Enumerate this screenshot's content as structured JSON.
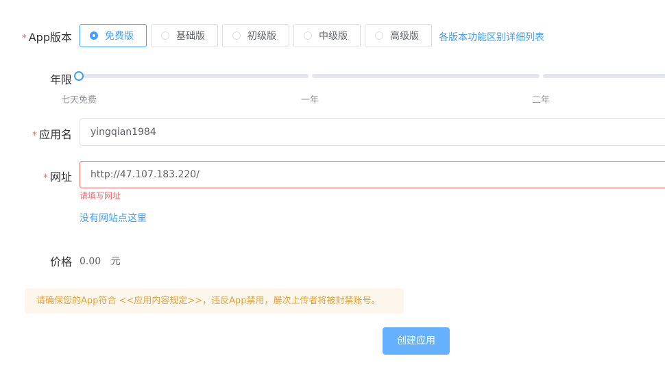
{
  "form": {
    "version": {
      "label": "App版本",
      "options": [
        "免费版",
        "基础版",
        "初级版",
        "中级版",
        "高级版"
      ],
      "selected": "免费版",
      "compare_link": "各版本功能区别详细列表"
    },
    "years": {
      "label": "年限",
      "ticks": [
        "七天免费",
        "一年",
        "二年"
      ],
      "value": "七天免费"
    },
    "app_name": {
      "label": "应用名",
      "value": "yingqian1984"
    },
    "website": {
      "label": "网址",
      "value": "http://47.107.183.220/",
      "error": "请填写网址",
      "help_link": "没有网站点这里"
    },
    "price": {
      "label": "价格",
      "value": "0.00",
      "unit": "元"
    }
  },
  "notice": "请确保您的App符合 <<应用内容规定>>，违反App禁用，屡次上传者将被封禁账号。",
  "submit_label": "创建应用",
  "colors": {
    "primary": "#409eff",
    "error": "#f56c6c",
    "warning": "#e6a23c"
  }
}
